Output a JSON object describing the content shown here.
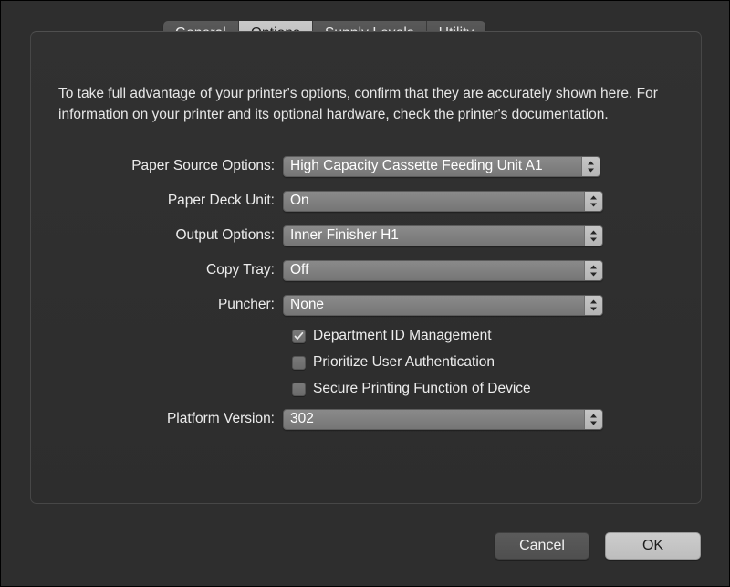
{
  "tabs": [
    {
      "label": "General",
      "selected": false
    },
    {
      "label": "Options",
      "selected": true
    },
    {
      "label": "Supply Levels",
      "selected": false
    },
    {
      "label": "Utility",
      "selected": false
    }
  ],
  "description": "To take full advantage of your printer's options, confirm that they are accurately shown here. For information on your printer and its optional hardware, check the printer's documentation.",
  "option_rows": [
    {
      "label": "Paper Source Options:",
      "value": "High Capacity Cassette Feeding Unit A1"
    },
    {
      "label": "Paper Deck Unit:",
      "value": "On"
    },
    {
      "label": "Output Options:",
      "value": "Inner Finisher H1"
    },
    {
      "label": "Copy Tray:",
      "value": "Off"
    },
    {
      "label": "Puncher:",
      "value": "None"
    }
  ],
  "checkboxes": [
    {
      "label": "Department ID Management",
      "checked": true
    },
    {
      "label": "Prioritize User Authentication",
      "checked": false
    },
    {
      "label": "Secure Printing Function of Device",
      "checked": false
    }
  ],
  "platform_row": {
    "label": "Platform Version:",
    "value": "302"
  },
  "buttons": {
    "cancel": "Cancel",
    "ok": "OK"
  },
  "icons": {
    "stepper": "chevron-up-down-icon",
    "check": "checkmark-icon"
  },
  "colors": {
    "window_background": "#2e2e2e",
    "panel_background": "#303030",
    "selected_tab": "#c2c2c2",
    "popup_fill": "#7f7f7f",
    "stepper_fill": "#bdbdbd",
    "default_button": "#c5c5c5",
    "text": "#ededed"
  }
}
